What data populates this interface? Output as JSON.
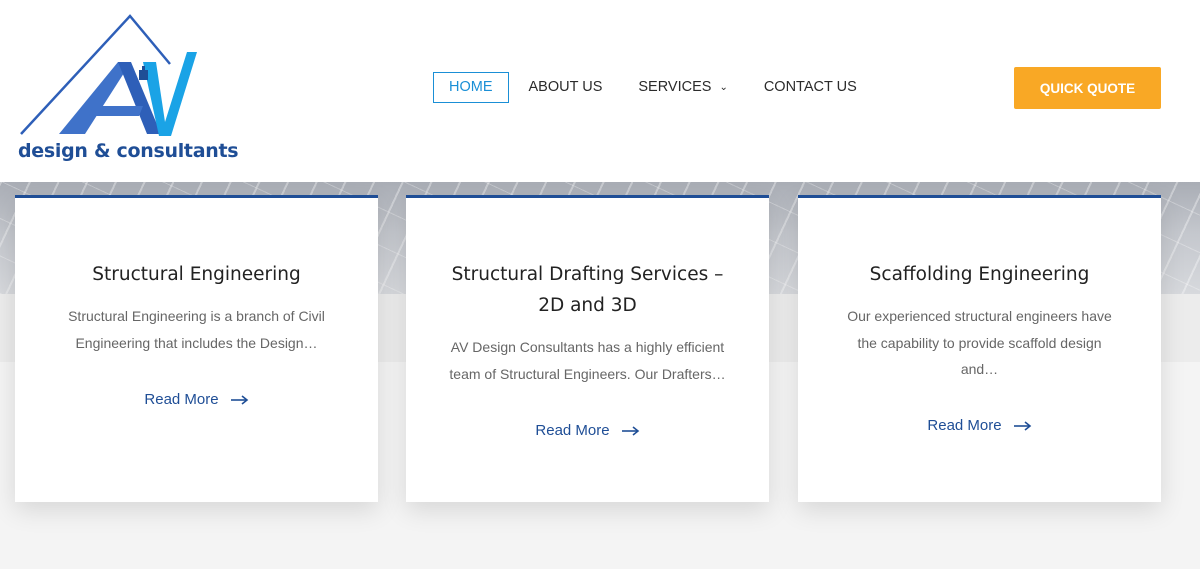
{
  "logo": {
    "text": "design & consultants",
    "brand_color": "#1f4e96",
    "accent_color": "#1aa3e6"
  },
  "nav": {
    "items": [
      {
        "label": "HOME",
        "active": true
      },
      {
        "label": "ABOUT US",
        "active": false
      },
      {
        "label": "SERVICES",
        "active": false,
        "has_dropdown": true,
        "icon": "chevron-down-icon"
      },
      {
        "label": "CONTACT US",
        "active": false
      }
    ],
    "cta_label": "QUICK QUOTE",
    "cta_color": "#f9a825",
    "active_color": "#1a8fd6"
  },
  "cards": [
    {
      "title": "Structural Engineering",
      "desc_lines": [
        "Structural Engineering is a branch of Civil",
        "Engineering that includes the Design…"
      ],
      "link": "Read More"
    },
    {
      "title_lines": [
        "Structural Drafting Services –",
        "2D and 3D"
      ],
      "desc_lines": [
        "AV Design Consultants has a highly efficient",
        "team of Structural Engineers. Our Drafters…"
      ],
      "link": "Read More"
    },
    {
      "title": "Scaffolding Engineering",
      "desc_lines": [
        "Our experienced structural engineers have",
        "the capability to provide scaffold design",
        "and…"
      ],
      "link": "Read More"
    }
  ]
}
